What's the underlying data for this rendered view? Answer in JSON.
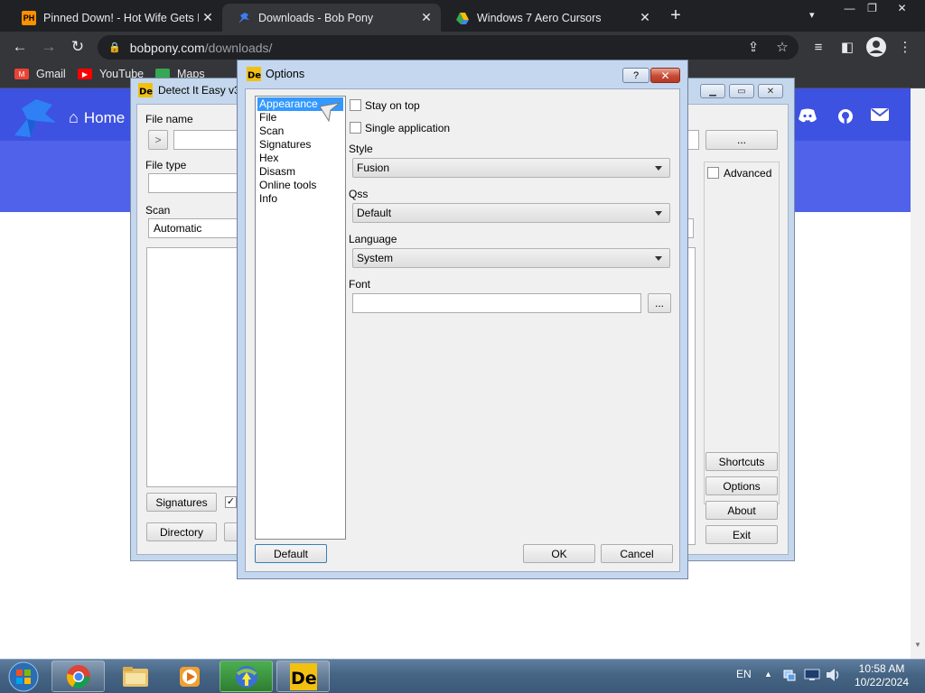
{
  "browser": {
    "tabs": [
      {
        "favicon": "PH",
        "title": "Pinned Down! - Hot Wife Gets Po",
        "active": false
      },
      {
        "favicon": "bobpony-icon",
        "title": "Downloads - Bob Pony",
        "active": true
      },
      {
        "favicon": "google-drive-icon",
        "title": "Windows 7 Aero Cursors",
        "active": false
      }
    ],
    "new_tab": "+",
    "url_host": "bobpony.com",
    "url_path": "/downloads/",
    "bookmarks": [
      {
        "label": "Gmail",
        "icon": "gmail-icon",
        "color": "#ea4335"
      },
      {
        "label": "YouTube",
        "icon": "youtube-icon",
        "color": "#ff0000"
      },
      {
        "label": "Maps",
        "icon": "maps-icon",
        "color": "#34a853"
      }
    ]
  },
  "website": {
    "home_label": "Home",
    "brand_color": "#4f62e9"
  },
  "die": {
    "title": "Detect It Easy v3.",
    "file_name_label": "File name",
    "browse_label": "...",
    "open_label": ">",
    "file_type_label": "File type",
    "scan_label": "Scan",
    "scan_value": "Automatic",
    "advanced_label": "Advanced",
    "signatures_button": "Signatures",
    "directory_button": "Directory",
    "shortcuts_button": "Shortcuts",
    "options_button": "Options",
    "about_button": "About",
    "exit_button": "Exit"
  },
  "options": {
    "title": "Options",
    "help_label": "?",
    "categories": [
      "Appearance",
      "File",
      "Scan",
      "Signatures",
      "Hex",
      "Disasm",
      "Online tools",
      "Info"
    ],
    "selected_category": "Appearance",
    "stay_on_top": "Stay on top",
    "single_application": "Single application",
    "style_label": "Style",
    "style_value": "Fusion",
    "qss_label": "Qss",
    "qss_value": "Default",
    "language_label": "Language",
    "language_value": "System",
    "font_label": "Font",
    "font_value": "",
    "font_browse": "...",
    "default_button": "Default",
    "ok_button": "OK",
    "cancel_button": "Cancel"
  },
  "taskbar": {
    "language": "EN",
    "time": "10:58 AM",
    "date": "10/22/2024"
  }
}
